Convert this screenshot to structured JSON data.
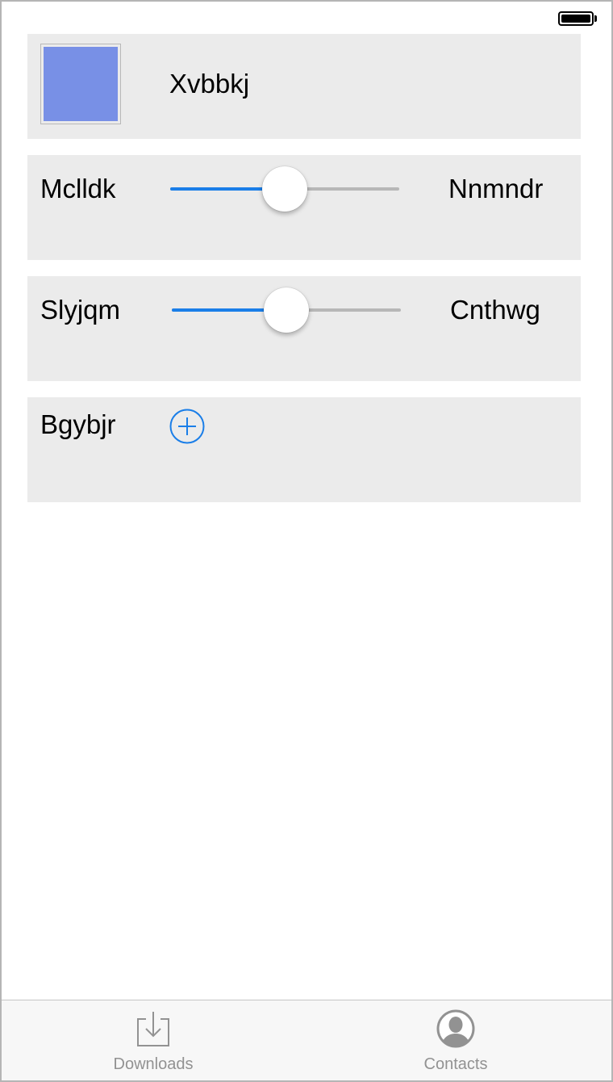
{
  "colors": {
    "accent": "#1a7ee8",
    "swatch": "#7890e6",
    "card_bg": "#ebebeb",
    "tab_inactive": "#929292"
  },
  "cards": [
    {
      "type": "color",
      "label": "Xvbbkj"
    },
    {
      "type": "slider",
      "left_label": "Mclldk",
      "right_label": "Nnmndr",
      "value": 0.5
    },
    {
      "type": "slider",
      "left_label": "Slyjqm",
      "right_label": "Cnthwg",
      "value": 0.5
    },
    {
      "type": "add",
      "label": "Bgybjr",
      "button_icon": "plus-circle-icon"
    }
  ],
  "tab_bar": {
    "items": [
      {
        "label": "Downloads",
        "icon": "download-tray-icon",
        "selected": false
      },
      {
        "label": "Contacts",
        "icon": "contact-avatar-icon",
        "selected": false
      }
    ]
  }
}
